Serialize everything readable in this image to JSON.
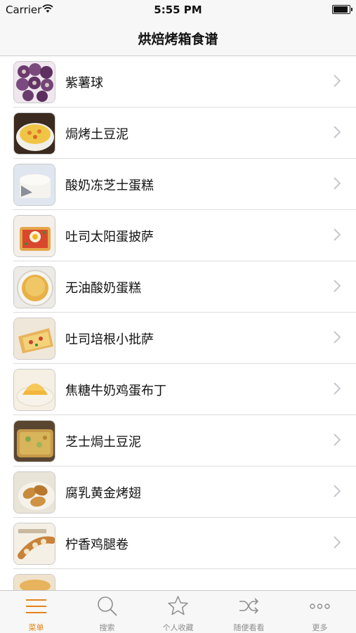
{
  "status_bar": {
    "carrier": "Carrier",
    "time": "5:55 PM"
  },
  "nav": {
    "title": "烘焙烤箱食谱"
  },
  "recipes": [
    {
      "label": "紫薯球",
      "thumb": "purple-sweet-potato-balls"
    },
    {
      "label": "焗烤土豆泥",
      "thumb": "baked-mashed-potato"
    },
    {
      "label": "酸奶冻芝士蛋糕",
      "thumb": "yogurt-cheesecake"
    },
    {
      "label": "吐司太阳蛋披萨",
      "thumb": "toast-egg-pizza"
    },
    {
      "label": "无油酸奶蛋糕",
      "thumb": "oil-free-yogurt-cake"
    },
    {
      "label": "吐司培根小批萨",
      "thumb": "toast-bacon-pizza"
    },
    {
      "label": "焦糖牛奶鸡蛋布丁",
      "thumb": "caramel-pudding"
    },
    {
      "label": "芝士焗土豆泥",
      "thumb": "cheese-baked-potato"
    },
    {
      "label": "腐乳黄金烤翅",
      "thumb": "roasted-wings"
    },
    {
      "label": "柠香鸡腿卷",
      "thumb": "lemon-chicken-roll"
    },
    {
      "label": "",
      "thumb": "partially-visible-dish"
    }
  ],
  "tabbar": {
    "items": [
      {
        "label": "菜单",
        "icon": "menu-icon",
        "active": true
      },
      {
        "label": "搜索",
        "icon": "search-icon",
        "active": false
      },
      {
        "label": "个人收藏",
        "icon": "star-icon",
        "active": false
      },
      {
        "label": "随便看看",
        "icon": "shuffle-icon",
        "active": false
      },
      {
        "label": "更多",
        "icon": "more-icon",
        "active": false
      }
    ]
  },
  "colors": {
    "accent": "#e5831a",
    "inactive": "#8e8e8e",
    "bar_bg": "#f7f7f7"
  }
}
